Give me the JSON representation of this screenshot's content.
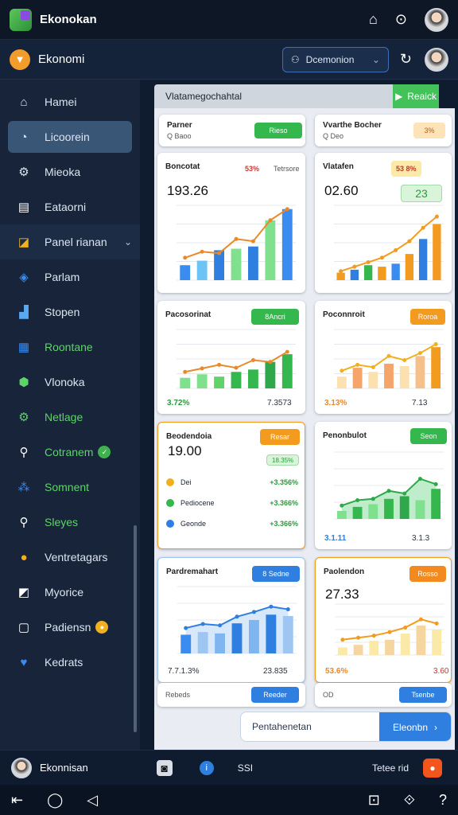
{
  "app": {
    "title": "Ekonokan",
    "section_title": "Ekonomi"
  },
  "dropdown": {
    "label": "Dcemonion"
  },
  "sidebar": {
    "items": [
      {
        "label": "Hamei",
        "icon": "home-icon"
      },
      {
        "label": "Licoorein",
        "icon": "chart-circle-icon"
      },
      {
        "label": "Mieoka",
        "icon": "gear-icon"
      },
      {
        "label": "Eataorni",
        "icon": "document-icon"
      },
      {
        "label": "Panel rianan",
        "icon": "folder-chart-icon"
      },
      {
        "label": "Parlam",
        "icon": "shield-icon"
      },
      {
        "label": "Stopen",
        "icon": "chart-up-icon"
      },
      {
        "label": "Roontane",
        "icon": "grid-icon"
      },
      {
        "label": "Vlonoka",
        "icon": "hexagon-icon"
      },
      {
        "label": "Netlage",
        "icon": "gear-icon"
      },
      {
        "label": "Cotranem",
        "icon": "search-icon"
      },
      {
        "label": "Somnent",
        "icon": "network-icon"
      },
      {
        "label": "Sleyes",
        "icon": "search-icon"
      },
      {
        "label": "Ventretagars",
        "icon": "coin-icon"
      },
      {
        "label": "Myorice",
        "icon": "chart-icon"
      },
      {
        "label": "Padiensn",
        "icon": "message-icon"
      },
      {
        "label": "Kedrats",
        "icon": "heart-icon"
      }
    ]
  },
  "search": {
    "placeholder": "Vlatamegochahtal",
    "button": "Reaick"
  },
  "cards": {
    "c1": {
      "title": "Parner",
      "sub": "Q Baoo",
      "chip": "Rieso"
    },
    "c2": {
      "title": "Vvarthe Bocher",
      "sub": "Q Deo",
      "chip": "3%"
    },
    "c3": {
      "title": "Boncotat",
      "chip1": "53%",
      "chip2": "Tetrsore",
      "value": "193.26"
    },
    "c4": {
      "title": "Vlatafen",
      "chip": "53 8%",
      "value": "02.60",
      "chip_big": "23"
    },
    "c5": {
      "title": "Pacosorinat",
      "chip": "8Ancri",
      "foot_left": "3.72%",
      "foot_right": "7.3573"
    },
    "c6": {
      "title": "Poconnroit",
      "chip": "Roroa",
      "foot_left": "3.13%",
      "foot_right": "7.13"
    },
    "c7": {
      "title": "Beodendoia",
      "chip": "Resar",
      "value": "19.00",
      "chip_small": "18.35%",
      "rows": [
        {
          "label": "Dei",
          "value": "+3.356%",
          "color": "#f2b01f"
        },
        {
          "label": "Pediocene",
          "value": "+3.366%",
          "color": "#34b74c"
        },
        {
          "label": "Geonde",
          "value": "+3.366%",
          "color": "#2f7fe0"
        }
      ]
    },
    "c8": {
      "title": "Penonbulot",
      "chip": "Seon",
      "foot_left": "3.1.11",
      "foot_right": "3.1.3"
    },
    "c9": {
      "title": "Pardremahart",
      "chip": "8 Sedne",
      "foot_left": "7.7.1.3%",
      "foot_right": "23.835"
    },
    "c10": {
      "title": "Paolendon",
      "chip": "Rosso",
      "value": "27.33",
      "foot_left": "53.6%",
      "foot_right": "3.60"
    }
  },
  "bottom_cards": {
    "left": "Rebeds",
    "left_btn": "Reeder",
    "right": "OD",
    "right_btn": "Tsenbe"
  },
  "bottom_search": {
    "placeholder": "Pentahenetan",
    "button": "Eleonbn"
  },
  "userbar": {
    "name": "Ekonnisan",
    "center": "SSI",
    "right": "Tetee rid"
  },
  "chart_data": [
    {
      "type": "bar",
      "values": [
        20,
        26,
        40,
        42,
        45,
        80,
        95
      ],
      "line": [
        30,
        38,
        36,
        55,
        52,
        80,
        95
      ]
    },
    {
      "type": "bar",
      "values": [
        10,
        14,
        20,
        18,
        22,
        35,
        55,
        75
      ],
      "line": [
        12,
        18,
        24,
        30,
        40,
        52,
        70,
        85
      ]
    },
    {
      "type": "bar",
      "values": [
        18,
        24,
        20,
        28,
        32,
        45,
        58
      ],
      "line": [
        28,
        34,
        40,
        35,
        48,
        45,
        62
      ]
    },
    {
      "type": "bar",
      "values": [
        20,
        35,
        28,
        42,
        38,
        55,
        70
      ],
      "line": [
        30,
        40,
        36,
        55,
        48,
        60,
        75
      ]
    },
    {
      "type": "bar",
      "values": [
        12,
        18,
        22,
        30,
        34,
        28,
        45
      ],
      "line": [
        20,
        28,
        30,
        42,
        38,
        60,
        52
      ]
    },
    {
      "type": "bar",
      "values": [
        28,
        32,
        30,
        45,
        50,
        58,
        56
      ],
      "line": [
        38,
        44,
        42,
        55,
        62,
        70,
        66
      ]
    },
    {
      "type": "bar",
      "values": [
        15,
        20,
        28,
        30,
        42,
        58,
        50
      ],
      "line": [
        30,
        34,
        38,
        45,
        54,
        70,
        62
      ]
    }
  ]
}
